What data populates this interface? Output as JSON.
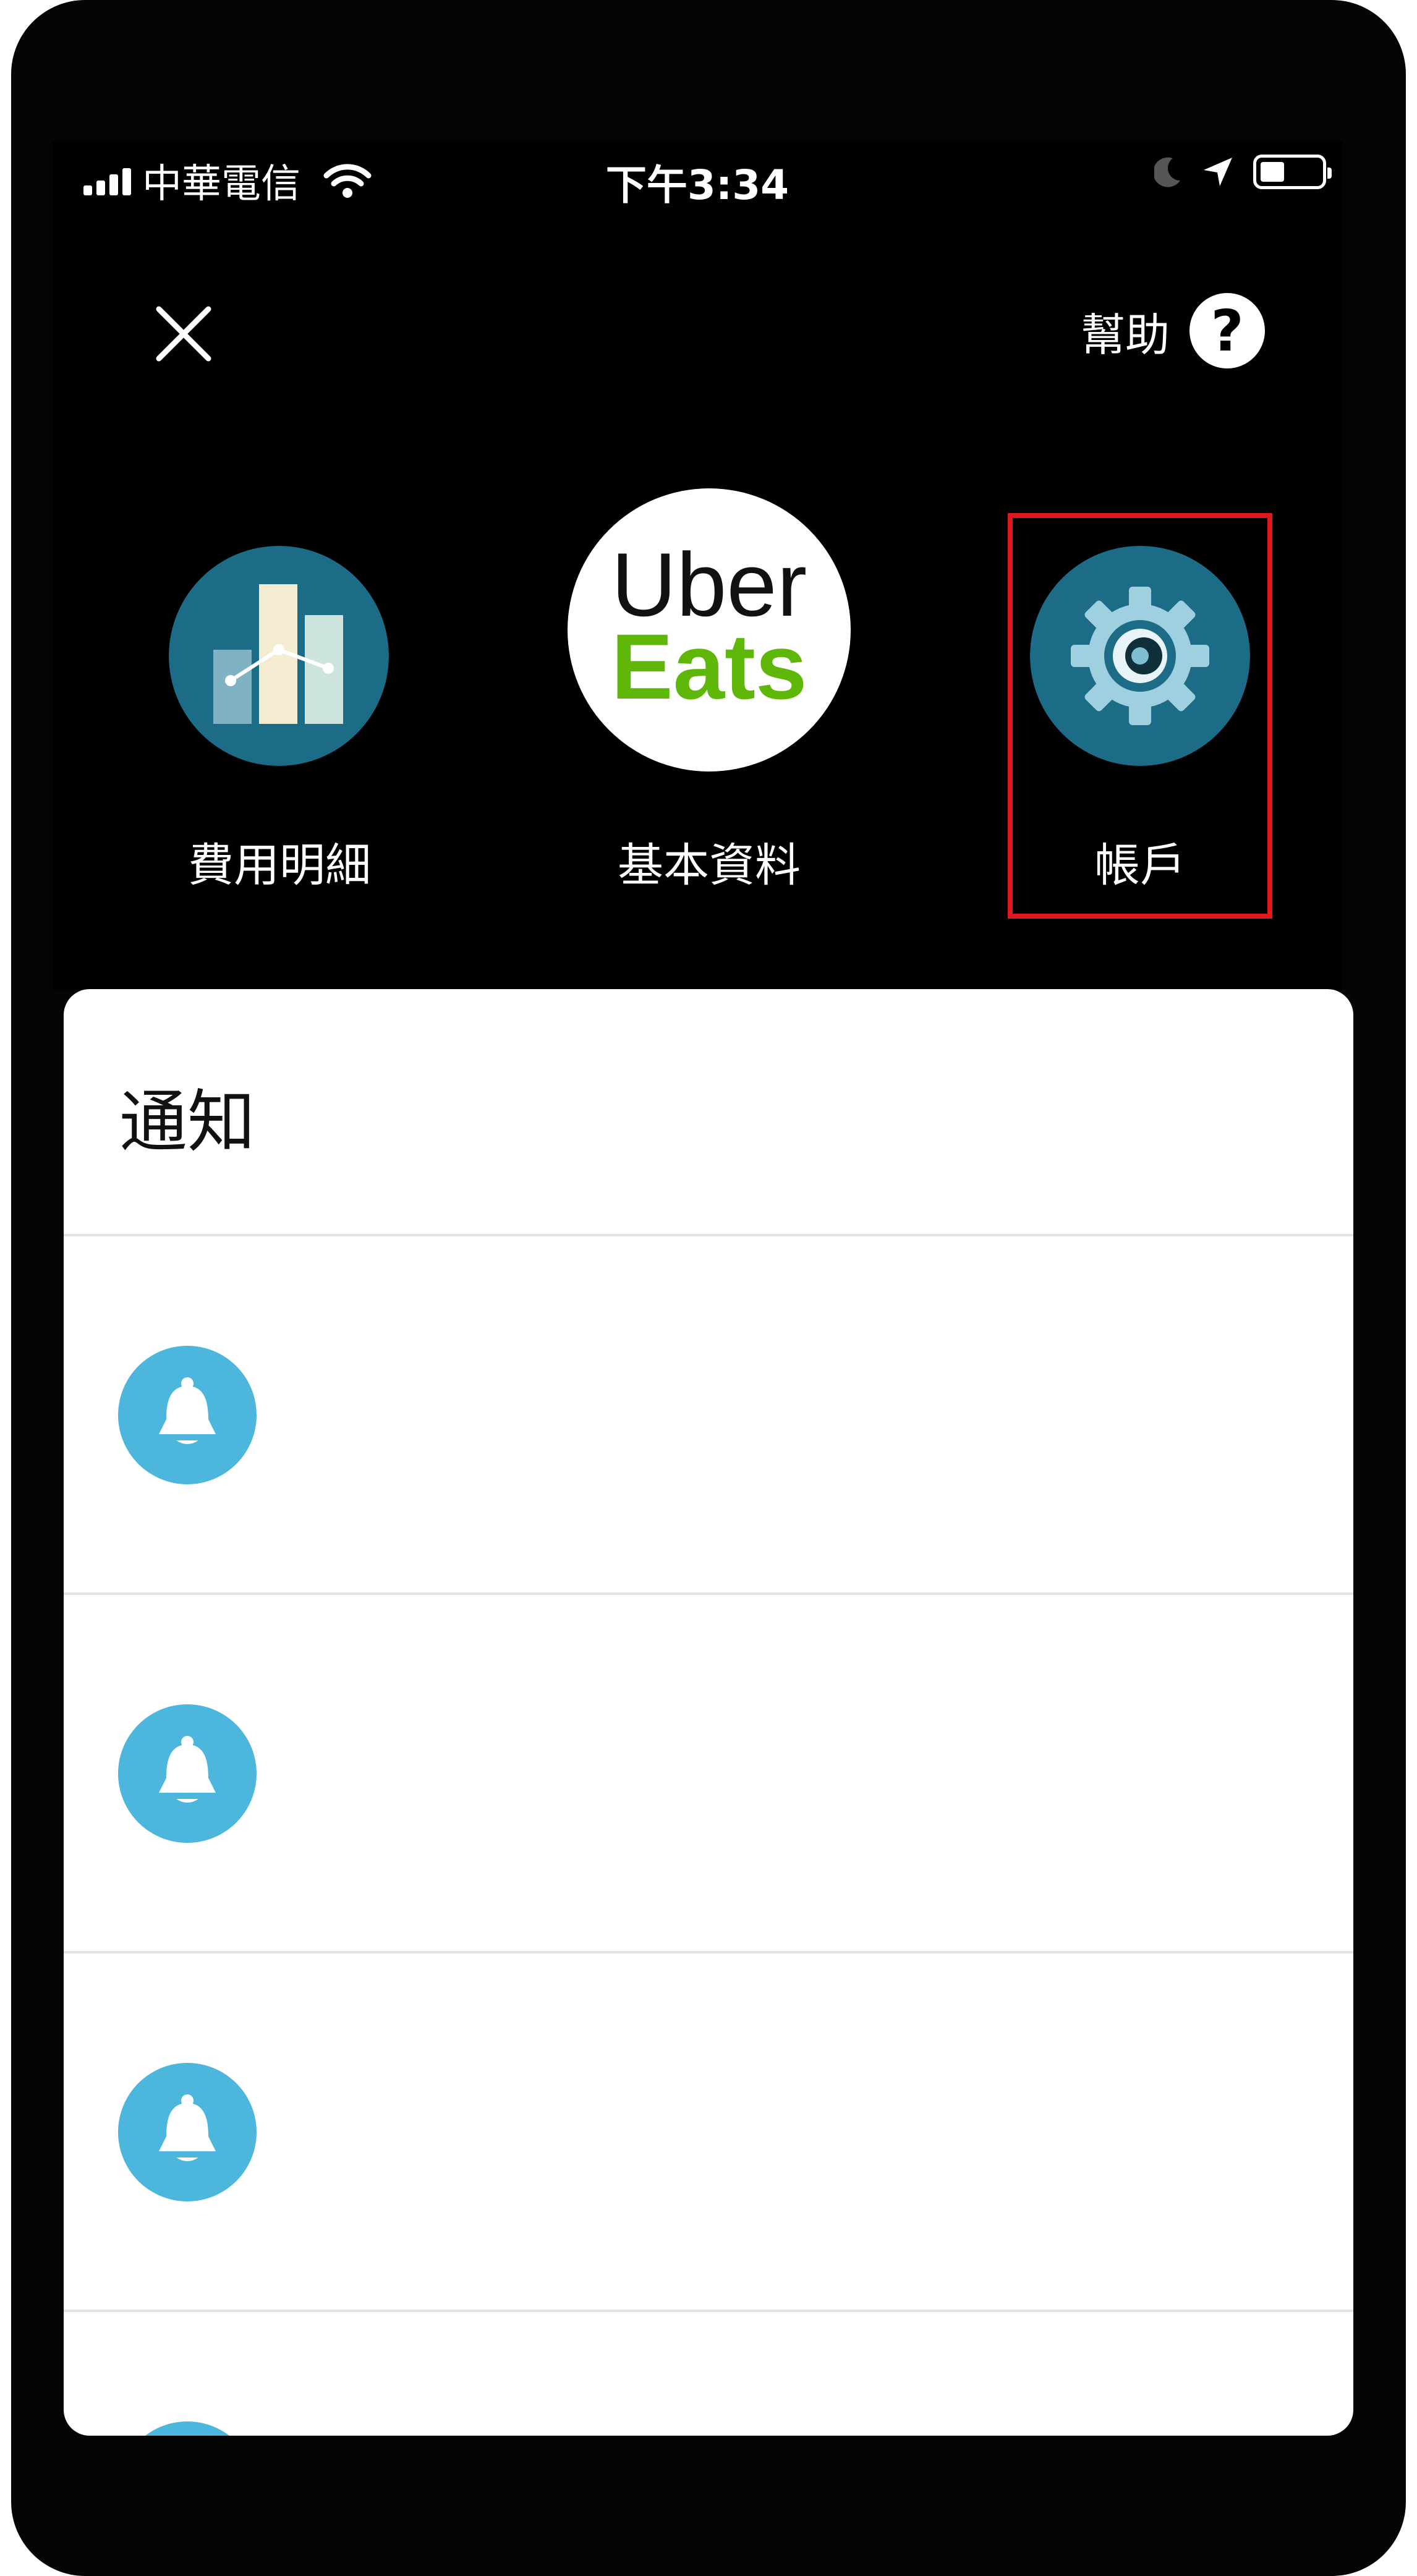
{
  "status_bar": {
    "carrier": "中華電信",
    "time": "下午3:34",
    "icons": [
      "signal-icon",
      "wifi-icon",
      "moon-icon",
      "location-arrow-icon",
      "battery-icon"
    ]
  },
  "header": {
    "close_icon": "close-icon",
    "help_label": "幫助",
    "help_icon_glyph": "?"
  },
  "menu": {
    "items": [
      {
        "label": "費用明細",
        "icon": "bar-chart-icon"
      },
      {
        "label": "基本資料",
        "icon": "uber-eats-logo",
        "logo_line1": "Uber",
        "logo_line2": "Eats"
      },
      {
        "label": "帳戶",
        "icon": "gear-icon",
        "highlighted": true
      }
    ]
  },
  "notifications": {
    "title": "通知",
    "rows": [
      {
        "icon": "bell-icon"
      },
      {
        "icon": "bell-icon"
      },
      {
        "icon": "bell-icon"
      },
      {
        "icon": "bell-icon"
      }
    ]
  },
  "colors": {
    "background": "#000000",
    "panel": "#ffffff",
    "bell_circle": "#4db6dd",
    "icon_circle": "#1d6c87",
    "uber_green": "#5fb709",
    "highlight": "#e0191e"
  }
}
